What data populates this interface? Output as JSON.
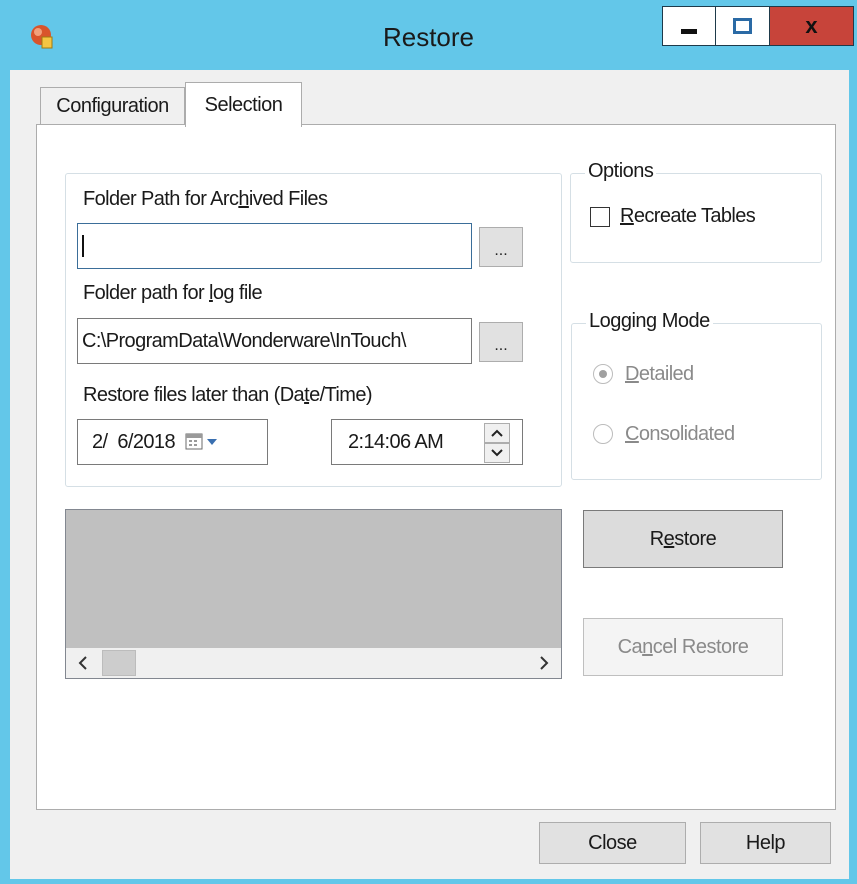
{
  "window": {
    "title": "Restore",
    "icon": "restore-app-icon",
    "controls": {
      "minimize": "minimize-icon",
      "maximize": "maximize-icon",
      "close": "x"
    }
  },
  "tabs": [
    {
      "label": "Configuration",
      "active": false
    },
    {
      "label": "Selection",
      "active": true
    }
  ],
  "paths": {
    "archived_label_pre": "Folder Path for Arc",
    "archived_label_u": "h",
    "archived_label_post": "ived Files",
    "archived_value": "",
    "log_label_pre": "Folder path for ",
    "log_label_u": "l",
    "log_label_post": "og file",
    "log_value": "C:\\ProgramData\\Wonderware\\InTouch\\",
    "browse_label": "...",
    "restore_after_label_pre": "Restore files later than (Da",
    "restore_after_label_u": "t",
    "restore_after_label_post": "e/Time)",
    "date_value": "2/  6/2018",
    "time_value": "2:14:06 AM"
  },
  "options": {
    "legend": "Options",
    "recreate_u": "R",
    "recreate_rest": "ecreate Tables",
    "recreate_checked": false
  },
  "logging": {
    "legend": "Logging Mode",
    "detailed_u": "D",
    "detailed_rest": "etailed",
    "consolidated_u": "C",
    "consolidated_rest": "onsolidated",
    "selected": "Detailed"
  },
  "actions": {
    "restore_pre": "R",
    "restore_u": "e",
    "restore_post": "store",
    "cancel_pre": "Ca",
    "cancel_u": "n",
    "cancel_post": "cel Restore"
  },
  "footer": {
    "close": "Close",
    "help": "Help"
  },
  "colors": {
    "titlebar": "#63c7e9",
    "close_button": "#c7443a",
    "dialog_bg": "#f0f0f0"
  }
}
